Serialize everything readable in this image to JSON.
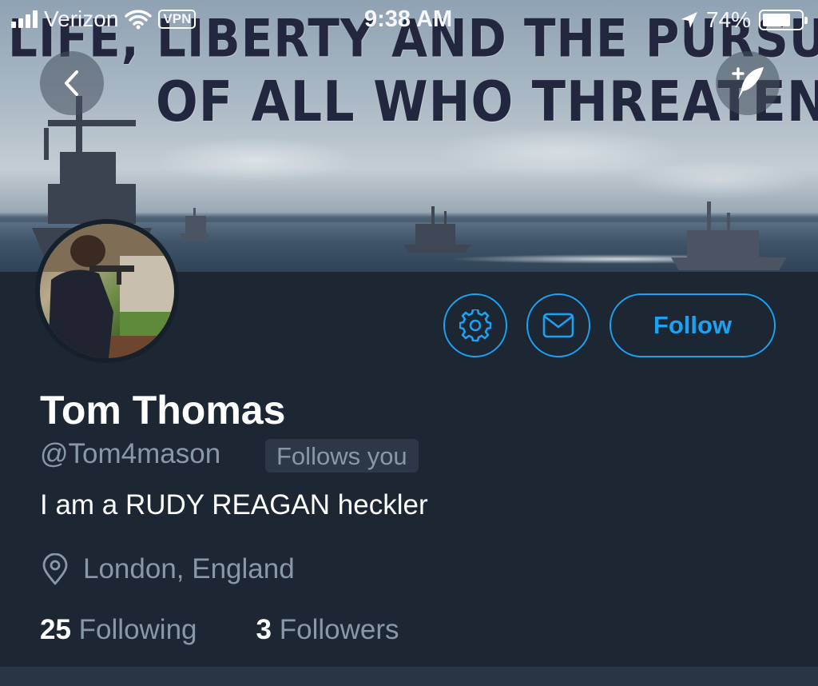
{
  "status_bar": {
    "carrier": "Verizon",
    "vpn_label": "VPN",
    "time": "9:38 AM",
    "battery_percent": "74%",
    "battery_level": 0.74
  },
  "header": {
    "banner_line1": "LIFE, LIBERTY AND THE PURSUIT",
    "banner_line2": "OF ALL WHO THREATEN IT.",
    "back_icon": "chevron-left-icon",
    "compose_icon": "feather-plus-icon"
  },
  "actions": {
    "settings_icon": "gear-icon",
    "message_icon": "envelope-icon",
    "follow_label": "Follow",
    "accent_color": "#1da1f2"
  },
  "profile": {
    "name": "Tom Thomas",
    "handle": "@Tom4mason",
    "follows_you_label": "Follows you",
    "bio": "I am a RUDY REAGAN heckler",
    "location_icon": "location-pin-icon",
    "location": "London, England",
    "following_count": "25",
    "following_label": "Following",
    "followers_count": "3",
    "followers_label": "Followers"
  }
}
